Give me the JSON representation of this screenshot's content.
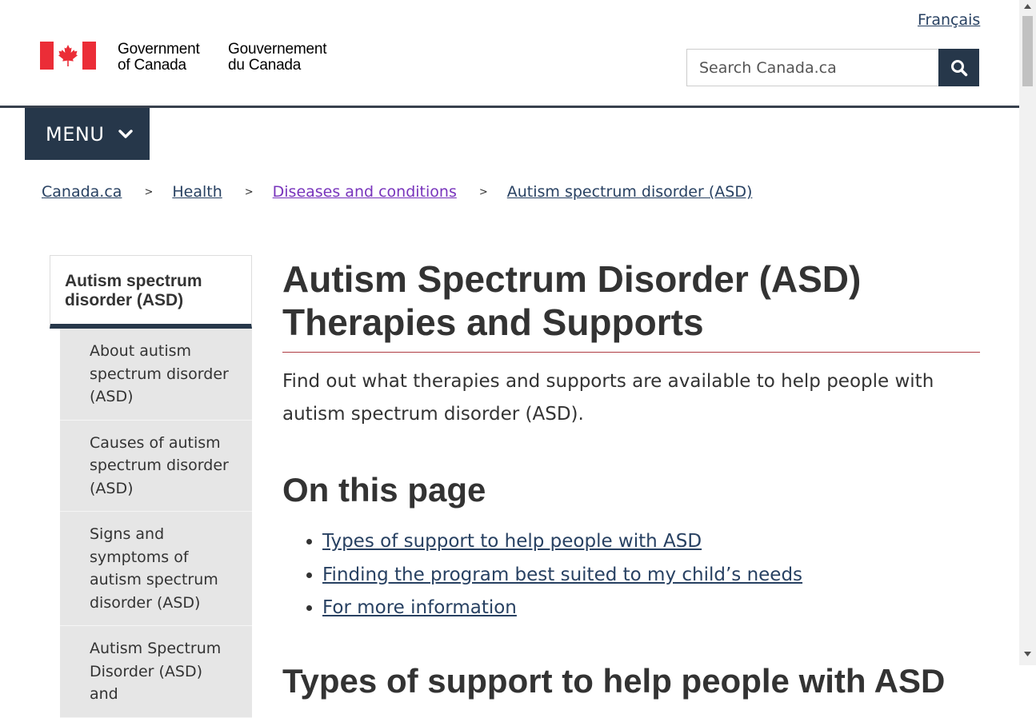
{
  "header": {
    "language_link": "Français",
    "wordmark_en_line1": "Government",
    "wordmark_en_line2": "of Canada",
    "wordmark_fr_line1": "Gouvernement",
    "wordmark_fr_line2": "du Canada",
    "search_placeholder": "Search Canada.ca",
    "colors": {
      "flag_red": "#eb2d37",
      "nav_dark": "#26374a",
      "link": "#284162",
      "visited_link": "#7834bc",
      "title_rule": "#af3c43"
    }
  },
  "menu": {
    "label": "MENU"
  },
  "breadcrumb": [
    {
      "label": "Canada.ca",
      "visited": false
    },
    {
      "label": "Health",
      "visited": false
    },
    {
      "label": "Diseases and conditions",
      "visited": true
    },
    {
      "label": "Autism spectrum disorder (ASD)",
      "visited": false
    }
  ],
  "breadcrumb_separator": ">",
  "sidebar": {
    "heading": "Autism spectrum disorder (ASD)",
    "items": [
      {
        "label": "About autism spectrum disorder (ASD)"
      },
      {
        "label": "Causes of autism spectrum disorder (ASD)"
      },
      {
        "label": "Signs and symptoms of autism spectrum disorder (ASD)"
      },
      {
        "label": "Autism Spectrum Disorder (ASD) and"
      }
    ]
  },
  "main": {
    "title": "Autism Spectrum Disorder (ASD) Therapies and Supports",
    "intro": "Find out what therapies and supports are available to help people with autism spectrum disorder (ASD).",
    "on_this_page_heading": "On this page",
    "toc": [
      {
        "label": "Types of support to help people with ASD"
      },
      {
        "label": "Finding the program best suited to my child’s needs"
      },
      {
        "label": "For more information"
      }
    ],
    "next_heading": "Types of support to help people with ASD"
  }
}
